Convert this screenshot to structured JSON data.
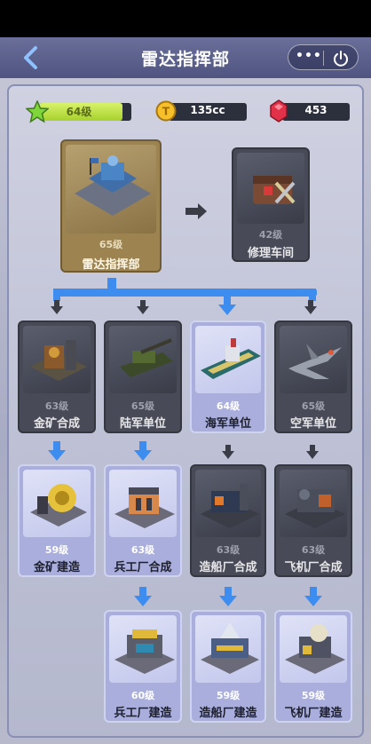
{
  "header": {
    "title": "雷达指挥部",
    "more_label": "•••"
  },
  "resources": {
    "level": {
      "label": "64级",
      "progress": 0.9,
      "color": "#b6dc3c"
    },
    "coins": {
      "value": "135cc",
      "icon": "coin-icon"
    },
    "gems": {
      "value": "453",
      "icon": "ruby-icon"
    }
  },
  "buildings": {
    "hq": {
      "level": "65级",
      "name": "雷达指挥部"
    },
    "repair": {
      "level": "42级",
      "name": "修理车间"
    }
  },
  "row1": [
    {
      "level": "63级",
      "name": "金矿合成",
      "state": "dark"
    },
    {
      "level": "65级",
      "name": "陆军单位",
      "state": "dark"
    },
    {
      "level": "64级",
      "name": "海军单位",
      "state": "lit"
    },
    {
      "level": "65级",
      "name": "空军单位",
      "state": "dark"
    }
  ],
  "row2": [
    {
      "level": "59级",
      "name": "金矿建造",
      "state": "lit"
    },
    {
      "level": "63级",
      "name": "兵工厂合成",
      "state": "lit"
    },
    {
      "level": "63级",
      "name": "造船厂合成",
      "state": "dark"
    },
    {
      "level": "63级",
      "name": "飞机厂合成",
      "state": "dark"
    }
  ],
  "row3": [
    {
      "level": "60级",
      "name": "兵工厂建造",
      "state": "lit"
    },
    {
      "level": "59级",
      "name": "造船厂建造",
      "state": "lit"
    },
    {
      "level": "59级",
      "name": "飞机厂建造",
      "state": "lit"
    }
  ],
  "colors": {
    "accent": "#3d8df0",
    "gold": "#9c8350",
    "panel": "#b9bbcf"
  }
}
